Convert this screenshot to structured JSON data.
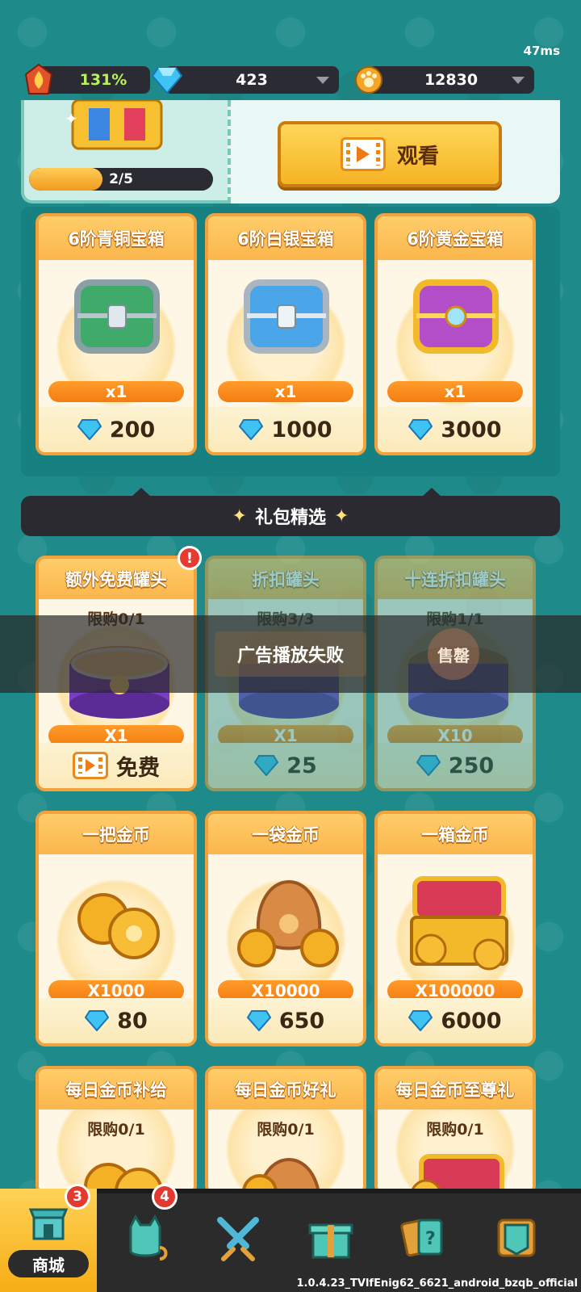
{
  "status": {
    "ping": "47ms"
  },
  "resources": {
    "power": {
      "value": "131%",
      "icon": "flame-crest-icon"
    },
    "gems": {
      "value": "423",
      "icon": "diamond-icon"
    },
    "coins": {
      "value": "12830",
      "icon": "paw-coin-icon"
    }
  },
  "banner": {
    "progress_text": "2/5",
    "progress_fraction": 0.4,
    "watch_label": "观看"
  },
  "chests": [
    {
      "title": "6阶青铜宝箱",
      "qty": "x1",
      "price": "200",
      "color": "#3fb77a"
    },
    {
      "title": "6阶白银宝箱",
      "qty": "x1",
      "price": "1000",
      "color": "#4aa6e8"
    },
    {
      "title": "6阶黄金宝箱",
      "qty": "x1",
      "price": "3000",
      "color": "#b24ec7"
    }
  ],
  "gift_section": {
    "title": "礼包精选"
  },
  "cans": [
    {
      "title": "额外免费罐头",
      "limit": "限购0/1",
      "qty": "X1",
      "price": "免费"
    },
    {
      "title": "折扣罐头",
      "limit": "限购3/3",
      "qty": "X1",
      "price": "25"
    },
    {
      "title": "十连折扣罐头",
      "limit": "限购1/1",
      "qty": "X10",
      "price": "250"
    }
  ],
  "toast": {
    "message": "广告播放失败",
    "soldout": "售罄"
  },
  "coins_packs": [
    {
      "title": "一把金币",
      "qty": "X1000",
      "price": "80"
    },
    {
      "title": "一袋金币",
      "qty": "X10000",
      "price": "650"
    },
    {
      "title": "一箱金币",
      "qty": "X100000",
      "price": "6000"
    }
  ],
  "daily_packs": [
    {
      "title": "每日金币补给",
      "limit": "限购0/1"
    },
    {
      "title": "每日金币好礼",
      "limit": "限购0/1"
    },
    {
      "title": "每日金币至尊礼",
      "limit": "限购0/1"
    }
  ],
  "nav": {
    "shop_label": "商城",
    "shop_badge": "3",
    "pets_badge": "4",
    "alert_mark": "!"
  },
  "version": "1.0.4.23_TVlfEnig62_6621_android_bzqb_official"
}
